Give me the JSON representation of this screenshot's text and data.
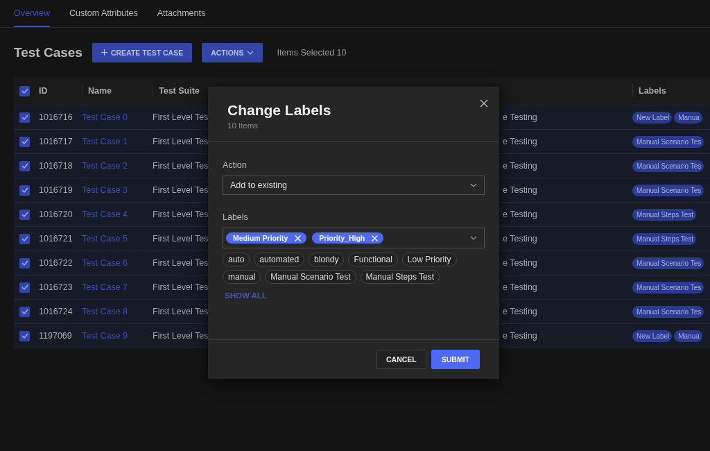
{
  "tabs": [
    {
      "label": "Overview",
      "selected": true
    },
    {
      "label": "Custom Attributes",
      "selected": false
    },
    {
      "label": "Attachments",
      "selected": false
    }
  ],
  "header": {
    "title": "Test Cases",
    "create_button": "CREATE TEST CASE",
    "actions_button": "ACTIONS",
    "selection_info": "Items Selected 10"
  },
  "table": {
    "all_checked": true,
    "columns": [
      "ID",
      "Name",
      "Test Suite",
      "Labels"
    ],
    "rows": [
      {
        "checked": true,
        "id": "1016716",
        "name": "Test Case 0",
        "test_suite": "First Level Tes",
        "column_4": "e Testing",
        "labels": [
          "New Label",
          "Manua"
        ]
      },
      {
        "checked": true,
        "id": "1016717",
        "name": "Test Case 1",
        "test_suite": "First Level Tes",
        "column_4": "e Testing",
        "labels": [
          "Manual Scenario Tes"
        ]
      },
      {
        "checked": true,
        "id": "1016718",
        "name": "Test Case 2",
        "test_suite": "First Level Tes",
        "column_4": "e Testing",
        "labels": [
          "Manual Scenario Tes"
        ]
      },
      {
        "checked": true,
        "id": "1016719",
        "name": "Test Case 3",
        "test_suite": "First Level Tes",
        "column_4": "e Testing",
        "labels": [
          "Manual Scenario Tes"
        ]
      },
      {
        "checked": true,
        "id": "1016720",
        "name": "Test Case 4",
        "test_suite": "First Level Tes",
        "column_4": "e Testing",
        "labels": [
          "Manual Steps Test"
        ]
      },
      {
        "checked": true,
        "id": "1016721",
        "name": "Test Case 5",
        "test_suite": "First Level Tes",
        "column_4": "e Testing",
        "labels": [
          "Manual Steps Test"
        ]
      },
      {
        "checked": true,
        "id": "1016722",
        "name": "Test Case 6",
        "test_suite": "First Level Tes",
        "column_4": "e Testing",
        "labels": [
          "Manual Scenario Tes"
        ]
      },
      {
        "checked": true,
        "id": "1016723",
        "name": "Test Case 7",
        "test_suite": "First Level Tes",
        "column_4": "e Testing",
        "labels": [
          "Manual Scenario Tes"
        ]
      },
      {
        "checked": true,
        "id": "1016724",
        "name": "Test Case 8",
        "test_suite": "First Level Tes",
        "column_4": "e Testing",
        "labels": [
          "Manual Scenario Tes"
        ]
      },
      {
        "checked": true,
        "id": "1197069",
        "name": "Test Case 9",
        "test_suite": "First Level Tes",
        "column_4": "e Testing",
        "labels": [
          "New Label",
          "Manua"
        ]
      }
    ]
  },
  "dialog": {
    "title": "Change Labels",
    "subtitle": "10 Items",
    "action": {
      "label": "Action",
      "value": "Add to existing"
    },
    "labels": {
      "label": "Labels",
      "selected": [
        "Medium Priority",
        "Priority_High"
      ],
      "options": [
        "auto",
        "automated",
        "blondy",
        "Functional",
        "Low Priority",
        "manual",
        "Manual Scenario Test",
        "Manual Steps Test"
      ],
      "show_all": "SHOW ALL"
    },
    "cancel": "CANCEL",
    "submit": "SUBMIT"
  }
}
